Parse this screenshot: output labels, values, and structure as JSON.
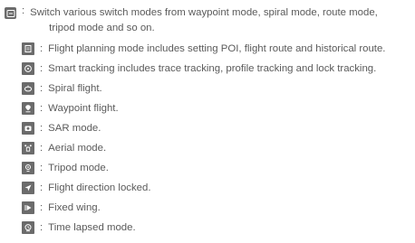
{
  "main": {
    "icon": "mode-switch-icon",
    "colon": ":",
    "text_line1": "Switch various switch modes from waypoint mode, spiral mode, route mode,",
    "text_line2": "tripod mode and so on."
  },
  "items": [
    {
      "icon": "flight-planning-icon",
      "text": "Flight planning mode includes setting POI, flight route and historical route."
    },
    {
      "icon": "smart-tracking-icon",
      "text": "Smart tracking includes trace tracking, profile tracking and lock tracking."
    },
    {
      "icon": "spiral-flight-icon",
      "text": "Spiral flight."
    },
    {
      "icon": "waypoint-flight-icon",
      "text": "Waypoint flight."
    },
    {
      "icon": "sar-mode-icon",
      "text": "SAR mode."
    },
    {
      "icon": "aerial-mode-icon",
      "text": "Aerial mode."
    },
    {
      "icon": "tripod-mode-icon",
      "text": "Tripod mode."
    },
    {
      "icon": "direction-locked-icon",
      "text": "Flight direction locked."
    },
    {
      "icon": "fixed-wing-icon",
      "text": "Fixed wing."
    },
    {
      "icon": "time-lapse-icon",
      "text": "Time lapsed mode."
    }
  ],
  "colors": {
    "icon_bg": "#6b6b6b",
    "text": "#5a5a5a"
  }
}
